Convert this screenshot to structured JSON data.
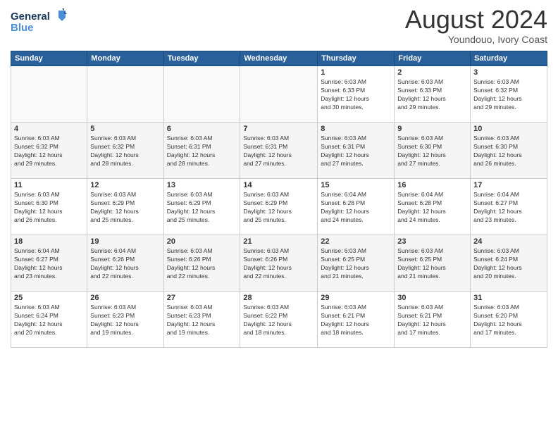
{
  "header": {
    "logo_line1": "General",
    "logo_line2": "Blue",
    "month_year": "August 2024",
    "location": "Youndouo, Ivory Coast"
  },
  "days_of_week": [
    "Sunday",
    "Monday",
    "Tuesday",
    "Wednesday",
    "Thursday",
    "Friday",
    "Saturday"
  ],
  "weeks": [
    [
      {
        "day": "",
        "info": ""
      },
      {
        "day": "",
        "info": ""
      },
      {
        "day": "",
        "info": ""
      },
      {
        "day": "",
        "info": ""
      },
      {
        "day": "1",
        "info": "Sunrise: 6:03 AM\nSunset: 6:33 PM\nDaylight: 12 hours\nand 30 minutes."
      },
      {
        "day": "2",
        "info": "Sunrise: 6:03 AM\nSunset: 6:33 PM\nDaylight: 12 hours\nand 29 minutes."
      },
      {
        "day": "3",
        "info": "Sunrise: 6:03 AM\nSunset: 6:32 PM\nDaylight: 12 hours\nand 29 minutes."
      }
    ],
    [
      {
        "day": "4",
        "info": "Sunrise: 6:03 AM\nSunset: 6:32 PM\nDaylight: 12 hours\nand 29 minutes."
      },
      {
        "day": "5",
        "info": "Sunrise: 6:03 AM\nSunset: 6:32 PM\nDaylight: 12 hours\nand 28 minutes."
      },
      {
        "day": "6",
        "info": "Sunrise: 6:03 AM\nSunset: 6:31 PM\nDaylight: 12 hours\nand 28 minutes."
      },
      {
        "day": "7",
        "info": "Sunrise: 6:03 AM\nSunset: 6:31 PM\nDaylight: 12 hours\nand 27 minutes."
      },
      {
        "day": "8",
        "info": "Sunrise: 6:03 AM\nSunset: 6:31 PM\nDaylight: 12 hours\nand 27 minutes."
      },
      {
        "day": "9",
        "info": "Sunrise: 6:03 AM\nSunset: 6:30 PM\nDaylight: 12 hours\nand 27 minutes."
      },
      {
        "day": "10",
        "info": "Sunrise: 6:03 AM\nSunset: 6:30 PM\nDaylight: 12 hours\nand 26 minutes."
      }
    ],
    [
      {
        "day": "11",
        "info": "Sunrise: 6:03 AM\nSunset: 6:30 PM\nDaylight: 12 hours\nand 26 minutes."
      },
      {
        "day": "12",
        "info": "Sunrise: 6:03 AM\nSunset: 6:29 PM\nDaylight: 12 hours\nand 25 minutes."
      },
      {
        "day": "13",
        "info": "Sunrise: 6:03 AM\nSunset: 6:29 PM\nDaylight: 12 hours\nand 25 minutes."
      },
      {
        "day": "14",
        "info": "Sunrise: 6:03 AM\nSunset: 6:29 PM\nDaylight: 12 hours\nand 25 minutes."
      },
      {
        "day": "15",
        "info": "Sunrise: 6:04 AM\nSunset: 6:28 PM\nDaylight: 12 hours\nand 24 minutes."
      },
      {
        "day": "16",
        "info": "Sunrise: 6:04 AM\nSunset: 6:28 PM\nDaylight: 12 hours\nand 24 minutes."
      },
      {
        "day": "17",
        "info": "Sunrise: 6:04 AM\nSunset: 6:27 PM\nDaylight: 12 hours\nand 23 minutes."
      }
    ],
    [
      {
        "day": "18",
        "info": "Sunrise: 6:04 AM\nSunset: 6:27 PM\nDaylight: 12 hours\nand 23 minutes."
      },
      {
        "day": "19",
        "info": "Sunrise: 6:04 AM\nSunset: 6:26 PM\nDaylight: 12 hours\nand 22 minutes."
      },
      {
        "day": "20",
        "info": "Sunrise: 6:03 AM\nSunset: 6:26 PM\nDaylight: 12 hours\nand 22 minutes."
      },
      {
        "day": "21",
        "info": "Sunrise: 6:03 AM\nSunset: 6:26 PM\nDaylight: 12 hours\nand 22 minutes."
      },
      {
        "day": "22",
        "info": "Sunrise: 6:03 AM\nSunset: 6:25 PM\nDaylight: 12 hours\nand 21 minutes."
      },
      {
        "day": "23",
        "info": "Sunrise: 6:03 AM\nSunset: 6:25 PM\nDaylight: 12 hours\nand 21 minutes."
      },
      {
        "day": "24",
        "info": "Sunrise: 6:03 AM\nSunset: 6:24 PM\nDaylight: 12 hours\nand 20 minutes."
      }
    ],
    [
      {
        "day": "25",
        "info": "Sunrise: 6:03 AM\nSunset: 6:24 PM\nDaylight: 12 hours\nand 20 minutes."
      },
      {
        "day": "26",
        "info": "Sunrise: 6:03 AM\nSunset: 6:23 PM\nDaylight: 12 hours\nand 19 minutes."
      },
      {
        "day": "27",
        "info": "Sunrise: 6:03 AM\nSunset: 6:23 PM\nDaylight: 12 hours\nand 19 minutes."
      },
      {
        "day": "28",
        "info": "Sunrise: 6:03 AM\nSunset: 6:22 PM\nDaylight: 12 hours\nand 18 minutes."
      },
      {
        "day": "29",
        "info": "Sunrise: 6:03 AM\nSunset: 6:21 PM\nDaylight: 12 hours\nand 18 minutes."
      },
      {
        "day": "30",
        "info": "Sunrise: 6:03 AM\nSunset: 6:21 PM\nDaylight: 12 hours\nand 17 minutes."
      },
      {
        "day": "31",
        "info": "Sunrise: 6:03 AM\nSunset: 6:20 PM\nDaylight: 12 hours\nand 17 minutes."
      }
    ]
  ]
}
